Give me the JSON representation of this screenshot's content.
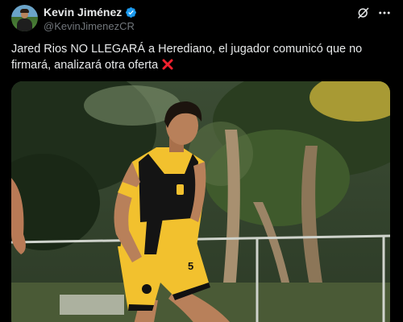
{
  "author": {
    "display_name": "Kevin Jiménez",
    "handle": "@KevinJimenezCR",
    "verified": true,
    "avatar_icon": "profile-photo"
  },
  "actions": {
    "grok_icon": "grok-icon",
    "more_icon": "more-options-icon"
  },
  "tweet": {
    "text": "Jared Rios NO LLEGARÁ a Herediano, el jugador comunicó que no firmará, analizará otra oferta",
    "emoji": "cross-mark-icon"
  },
  "media": {
    "type": "photo",
    "jersey_number": "5"
  },
  "colors": {
    "background": "#000000",
    "primary_text": "#e7e9ea",
    "secondary_text": "#71767b",
    "verified_blue": "#1d9bf0",
    "cross_red": "#f4212e",
    "jersey_yellow": "#f2c12e"
  }
}
